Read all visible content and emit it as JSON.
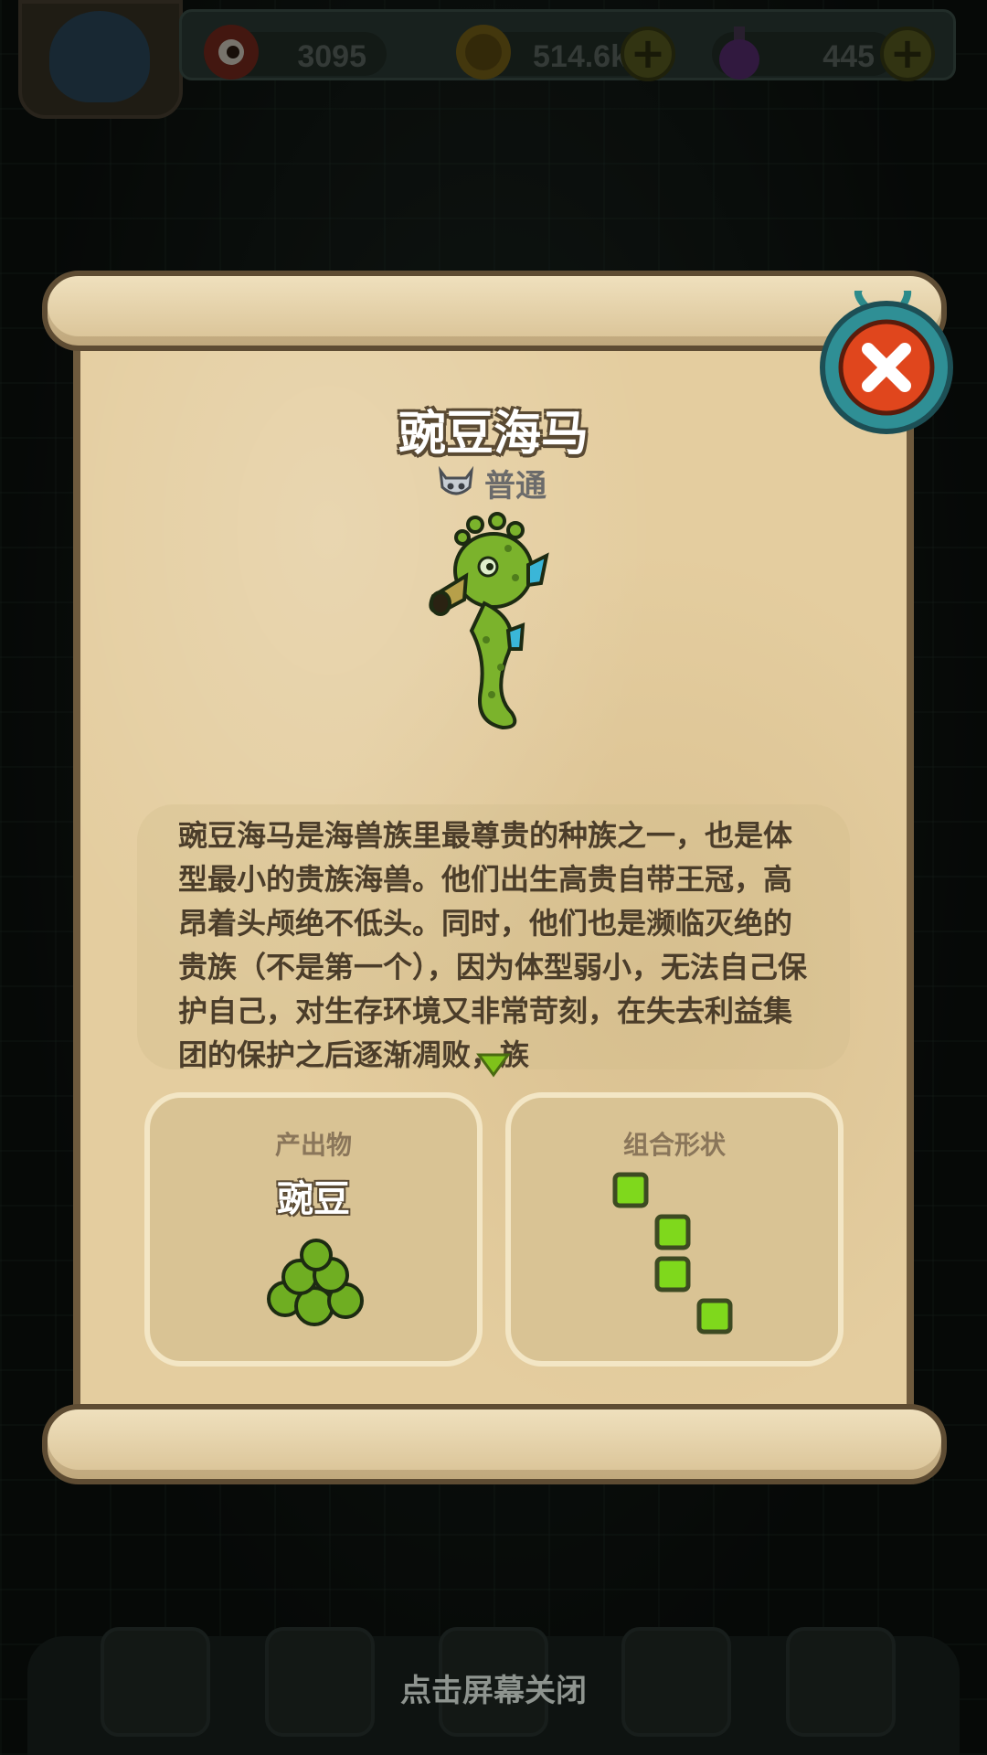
{
  "resources": {
    "gems": "3095",
    "coins": "514.6k",
    "potions": "445"
  },
  "popup": {
    "title": "豌豆海马",
    "rarity": "普通",
    "description": "豌豆海马是海兽族里最尊贵的种族之一，也是体型最小的贵族海兽。他们出生高贵自带王冠，高昂着头颅绝不低头。同时，他们也是濒临灭绝的贵族（不是第一个），因为体型弱小，无法自己保护自己，对生存环境又非常苛刻，在失去利益集团的保护之后逐渐凋败，族",
    "product_card": {
      "title": "产出物",
      "product_name": "豌豆"
    },
    "shape_card": {
      "title": "组合形状"
    }
  },
  "footer": {
    "tap_to_close": "点击屏幕关闭"
  },
  "colors": {
    "parchment": "#e4cd9f",
    "shape_cell": "#7fd81c",
    "close_button": "#e0461d"
  },
  "icons": {
    "gems": "eyeball-gem-icon",
    "coins": "gold-coin-icon",
    "potions": "purple-potion-icon",
    "rarity": "silver-helmet-icon",
    "close": "close-x-icon",
    "more": "chevron-down-icon"
  }
}
